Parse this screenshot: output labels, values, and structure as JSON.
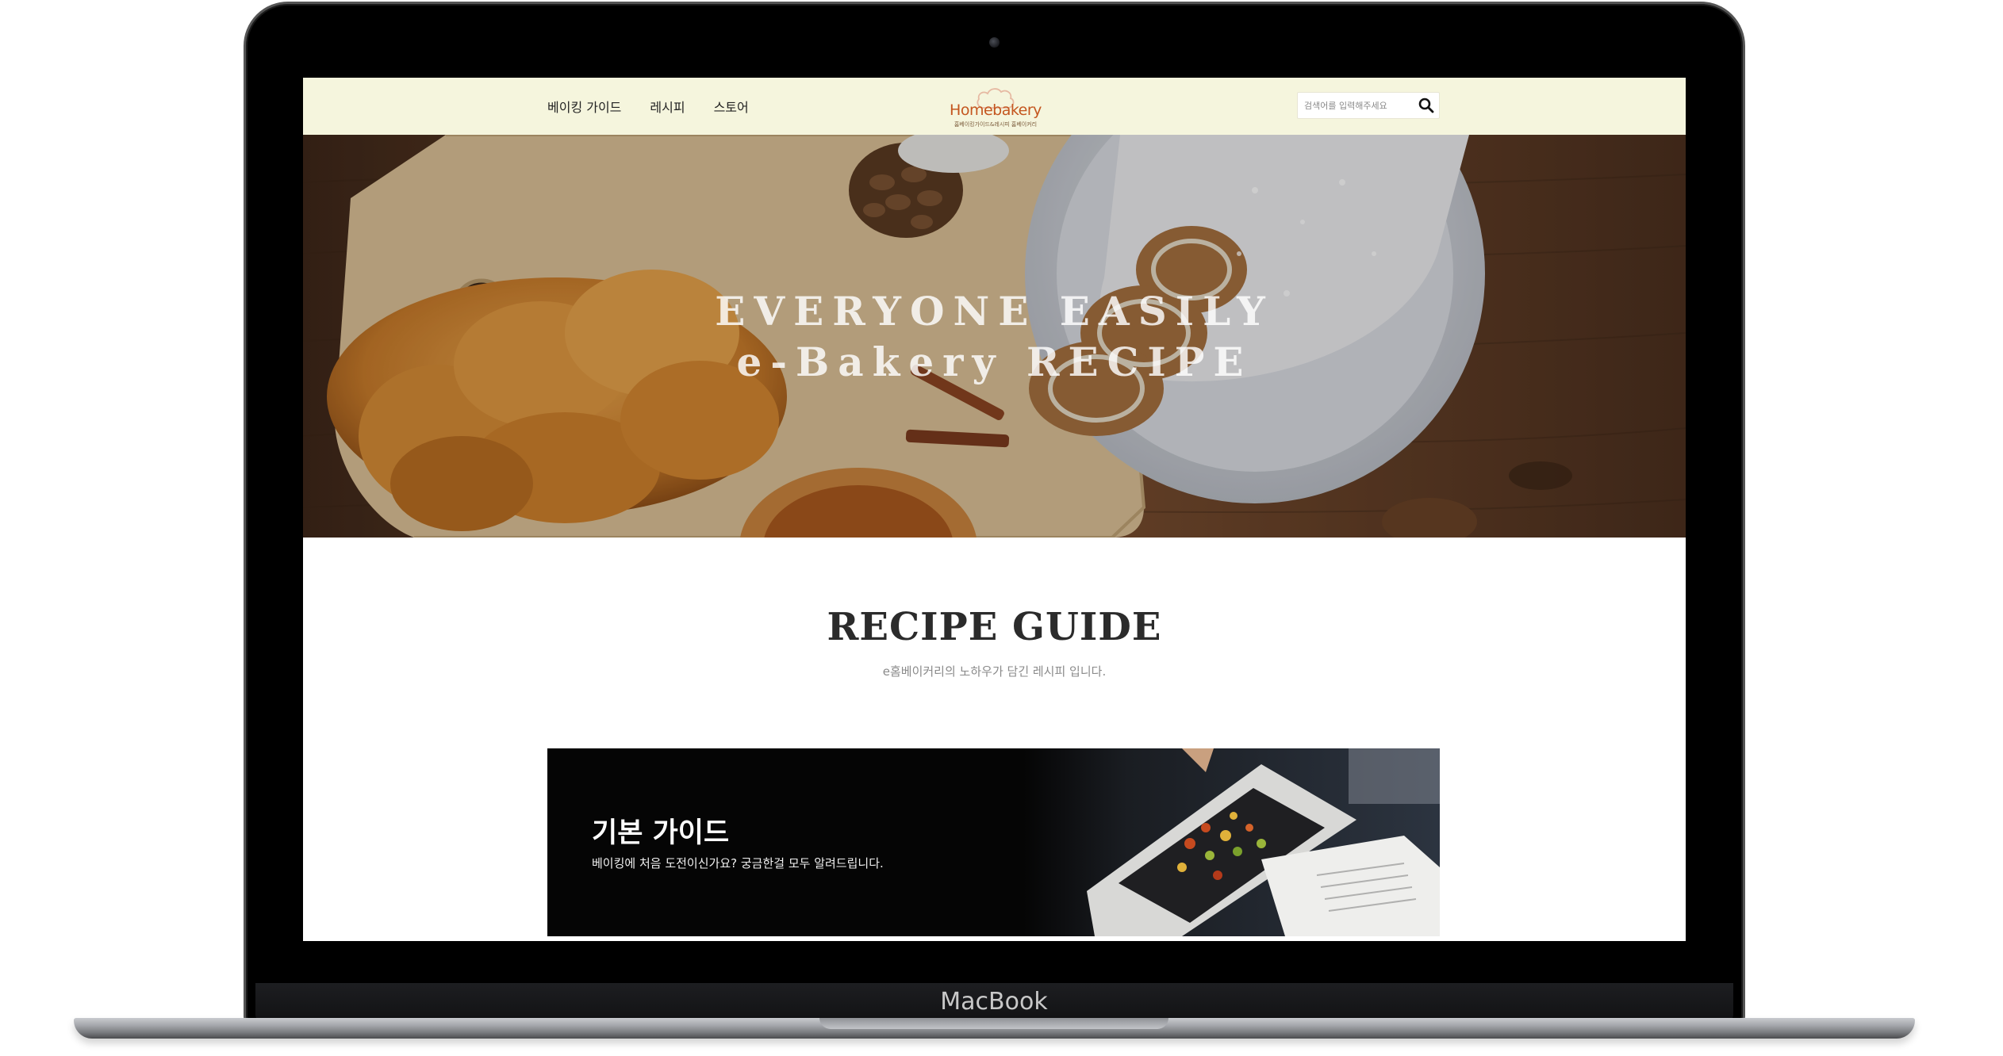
{
  "device": {
    "brand": "MacBook"
  },
  "header": {
    "nav": [
      "베이킹 가이드",
      "레시피",
      "스토어"
    ],
    "logo_text": "Homebakery",
    "logo_sub": "홈베이킹가이드&레시피 홈베이커리",
    "search_placeholder": "검색어를 입력해주세요",
    "search_icon": "search-icon"
  },
  "hero": {
    "line1": "EVERYONE EASILY",
    "line2": "e-Bakery RECIPE"
  },
  "recipe_guide": {
    "title": "RECIPE GUIDE",
    "subtitle": "e홈베이커리의 노하우가 담긴 레시피 입니다."
  },
  "guide_card": {
    "title": "기본 가이드",
    "description": "베이킹에 처음 도전이신가요? 궁금한걸 모두 알려드립니다."
  },
  "colors": {
    "header_bg": "#f5f5dd",
    "logo_accent": "#c4561f",
    "card_bg": "#050505"
  }
}
